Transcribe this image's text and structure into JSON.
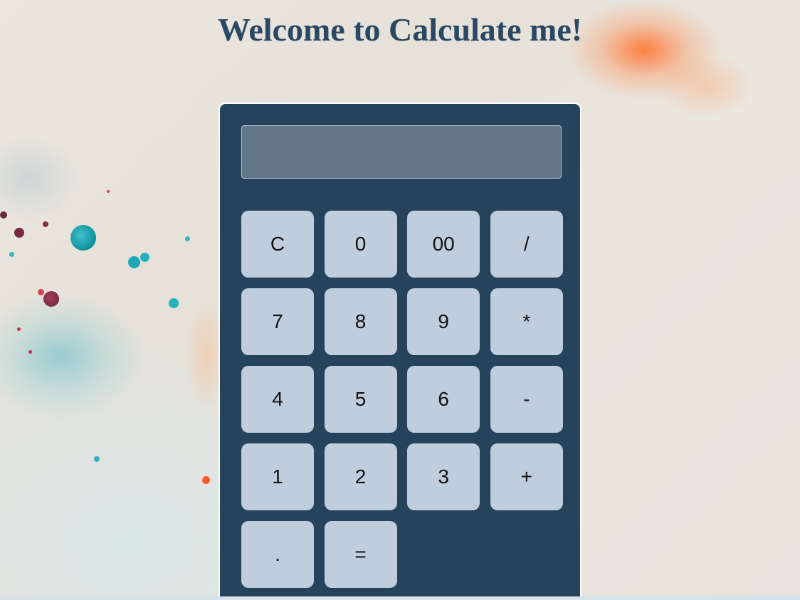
{
  "page": {
    "title": "Welcome to Calculate me!"
  },
  "calculator": {
    "display_value": "",
    "keys": [
      {
        "label": "C",
        "name": "clear-button"
      },
      {
        "label": "0",
        "name": "digit-0-button"
      },
      {
        "label": "00",
        "name": "digit-00-button"
      },
      {
        "label": "/",
        "name": "divide-button"
      },
      {
        "label": "7",
        "name": "digit-7-button"
      },
      {
        "label": "8",
        "name": "digit-8-button"
      },
      {
        "label": "9",
        "name": "digit-9-button"
      },
      {
        "label": "*",
        "name": "multiply-button"
      },
      {
        "label": "4",
        "name": "digit-4-button"
      },
      {
        "label": "5",
        "name": "digit-5-button"
      },
      {
        "label": "6",
        "name": "digit-6-button"
      },
      {
        "label": "-",
        "name": "subtract-button"
      },
      {
        "label": "1",
        "name": "digit-1-button"
      },
      {
        "label": "2",
        "name": "digit-2-button"
      },
      {
        "label": "3",
        "name": "digit-3-button"
      },
      {
        "label": "+",
        "name": "add-button"
      },
      {
        "label": ".",
        "name": "decimal-point-button"
      },
      {
        "label": "=",
        "name": "equals-button"
      }
    ]
  },
  "colors": {
    "title": "#2a4863",
    "calculator_body": "#26435c",
    "display": "#637788",
    "key": "#bfcddc"
  }
}
